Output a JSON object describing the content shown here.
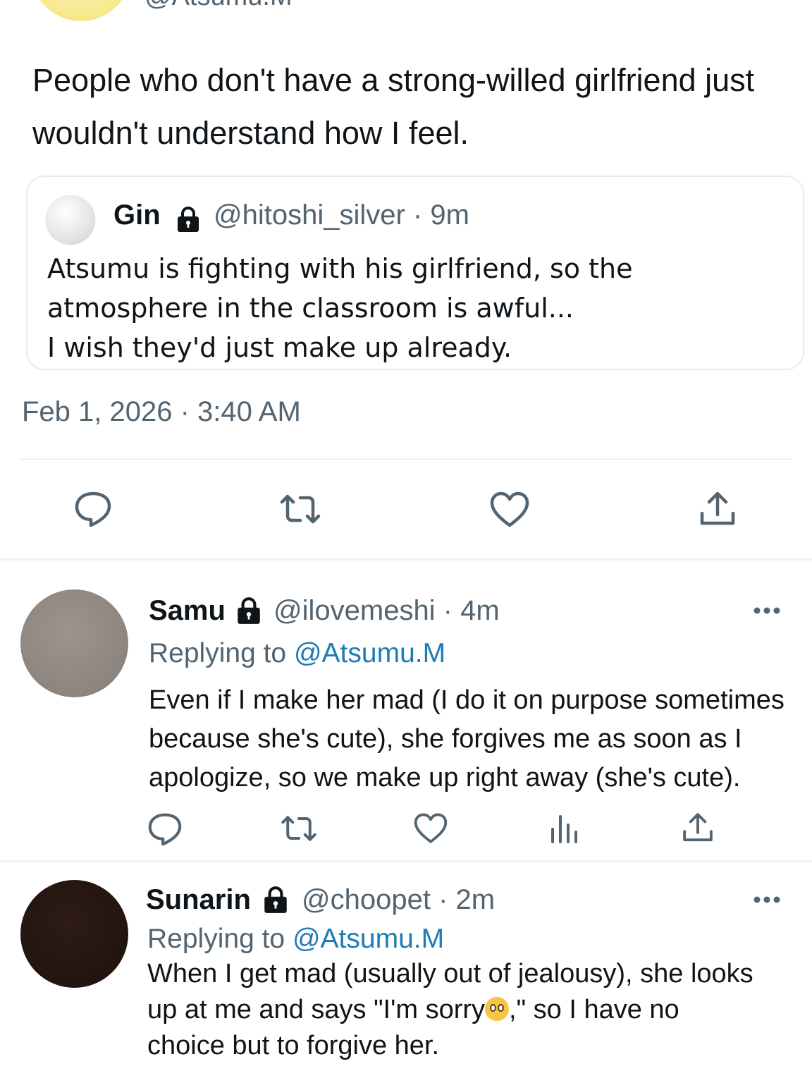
{
  "header": {
    "handle": "@Atsumu.M"
  },
  "tweet": {
    "text": "People who don't have a strong-willed girlfriend just wouldn't understand how I feel.",
    "timestamp": "Feb 1, 2026 · 3:40 AM",
    "quote": {
      "name": "Gin",
      "handle_time": "@hitoshi_silver · 9m",
      "lines": [
        "Atsumu is fighting with his girlfriend, so the",
        "atmosphere in the classroom is awful...",
        "I wish they'd just make up already."
      ]
    },
    "actions": [
      "reply-icon",
      "retweet-icon",
      "like-icon",
      "share-icon"
    ]
  },
  "replies": [
    {
      "name": "Samu",
      "handle_time": "@ilovemeshi · 4m",
      "replying_prefix": "Replying to ",
      "replying_to": "@Atsumu.M",
      "lines": [
        "Even if I make her mad (I do it on purpose sometimes",
        "because she's cute), she forgives me as soon as I",
        "apologize, so we make up right away (she's cute)."
      ],
      "avatar_color": "#8f8780"
    },
    {
      "name": "Sunarin",
      "handle_time": "@choopet · 2m",
      "replying_prefix": "Replying to ",
      "replying_to": "@Atsumu.M",
      "line1": "When I get mad (usually out of jealousy), she looks",
      "line2_before": "up at me and says \"I'm sorry",
      "line2_after": ",\" so I have no",
      "line3": "choice but to forgive her.",
      "emoji": "pleading-face-emoji",
      "avatar_color": "#241510"
    }
  ],
  "colors": {
    "text": "#0f1419",
    "secondary": "#536471",
    "mention": "#1d7bb8",
    "divider": "#eff3f4"
  }
}
